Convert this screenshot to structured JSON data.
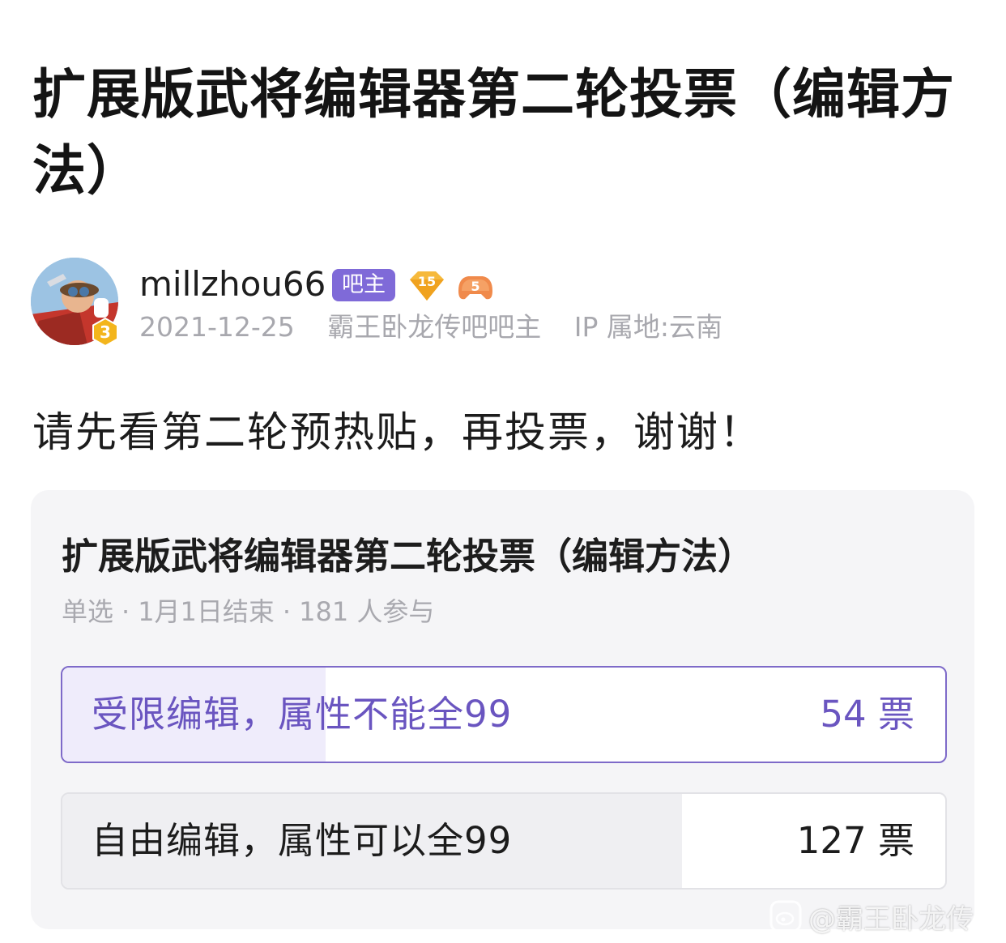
{
  "post": {
    "title": "扩展版武将编辑器第二轮投票（编辑方法）",
    "body": "请先看第二轮预热贴，再投票，谢谢！"
  },
  "author": {
    "name": "millzhou66",
    "role_badge": "吧主",
    "user_level": "15",
    "game_level": "5",
    "avatar_level": "3",
    "date": "2021-12-25",
    "title": "霸王卧龙传吧吧主",
    "ip_location": "IP 属地:云南"
  },
  "poll": {
    "title": "扩展版武将编辑器第二轮投票（编辑方法）",
    "type": "单选",
    "end": "1月1日结束",
    "participants": "181 人参与",
    "options": [
      {
        "label": "受限编辑，属性不能全99",
        "votes": "54 票",
        "count": 54,
        "share": 0.298,
        "selected": true
      },
      {
        "label": "自由编辑，属性可以全99",
        "votes": "127 票",
        "count": 127,
        "share": 0.702,
        "selected": false
      }
    ]
  },
  "watermark": {
    "text": "@霸王卧龙传"
  },
  "colors": {
    "accent": "#7f6ad8",
    "selected_text": "#6a55c0",
    "card_bg": "#f5f5f7",
    "meta_gray": "#a8a8ae"
  }
}
